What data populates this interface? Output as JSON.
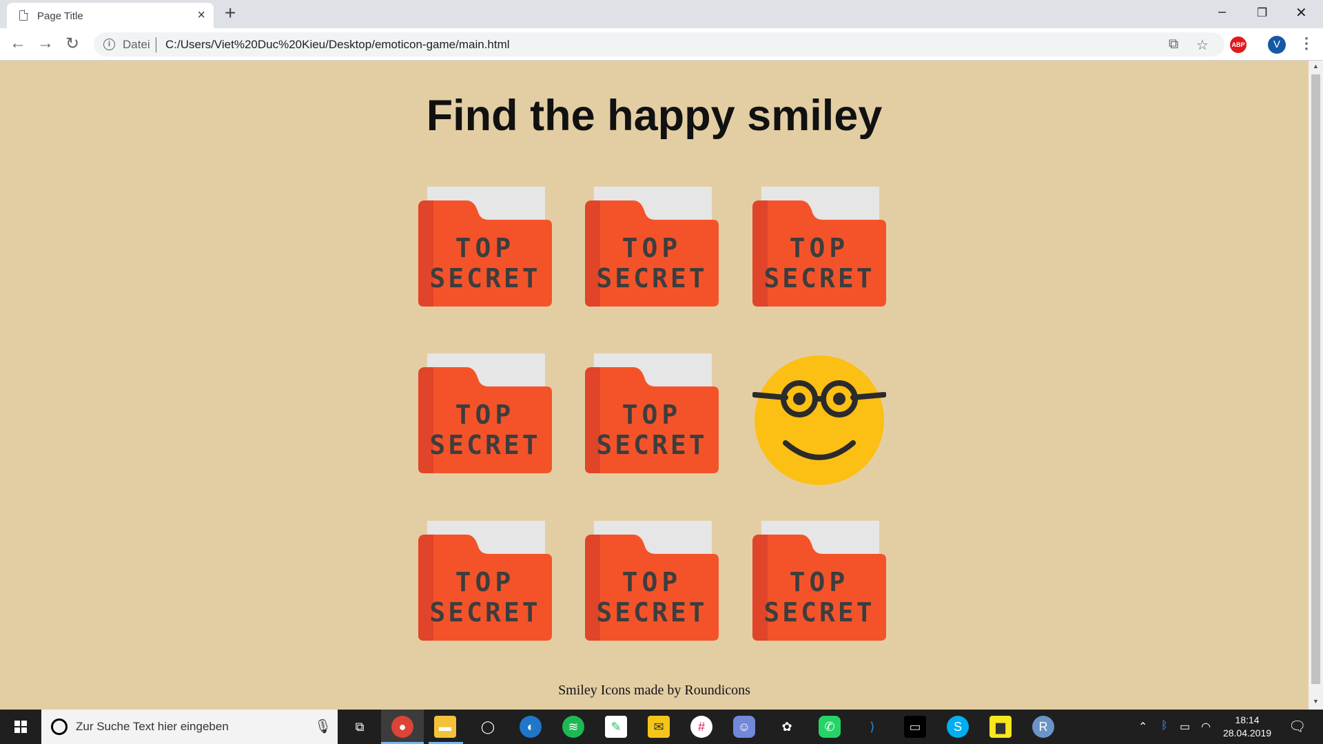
{
  "browser": {
    "tab_title": "Page Title",
    "url_scheme": "Datei",
    "url": "C:/Users/Viet%20Duc%20Kieu/Desktop/emoticon-game/main.html",
    "profile_initial": "V",
    "adblock_label": "ABP"
  },
  "page": {
    "heading": "Find the happy smiley",
    "folder_label_top": "TOP",
    "folder_label_bottom": "SECRET",
    "grid": [
      {
        "state": "folder"
      },
      {
        "state": "folder"
      },
      {
        "state": "folder"
      },
      {
        "state": "folder"
      },
      {
        "state": "folder"
      },
      {
        "state": "smiley-glasses"
      },
      {
        "state": "folder"
      },
      {
        "state": "folder"
      },
      {
        "state": "folder"
      }
    ],
    "credit": "Smiley Icons made by Roundicons"
  },
  "taskbar": {
    "search_placeholder": "Zur Suche Text hier eingeben",
    "time": "18:14",
    "date": "28.04.2019",
    "apps": [
      "task-view",
      "chrome",
      "file-explorer",
      "dell",
      "network-app",
      "spotify",
      "evernote",
      "mail",
      "slack",
      "discord",
      "paint",
      "whatsapp",
      "vscode",
      "terminal",
      "skype",
      "sticky-notes",
      "r-app"
    ]
  },
  "colors": {
    "page_bg": "#e3cea4",
    "folder_red": "#f4532a",
    "folder_shadow": "#e0452a",
    "paper": "#e6e6e6",
    "label_text": "#3d3d3d",
    "smiley_yellow": "#fcbf13"
  }
}
